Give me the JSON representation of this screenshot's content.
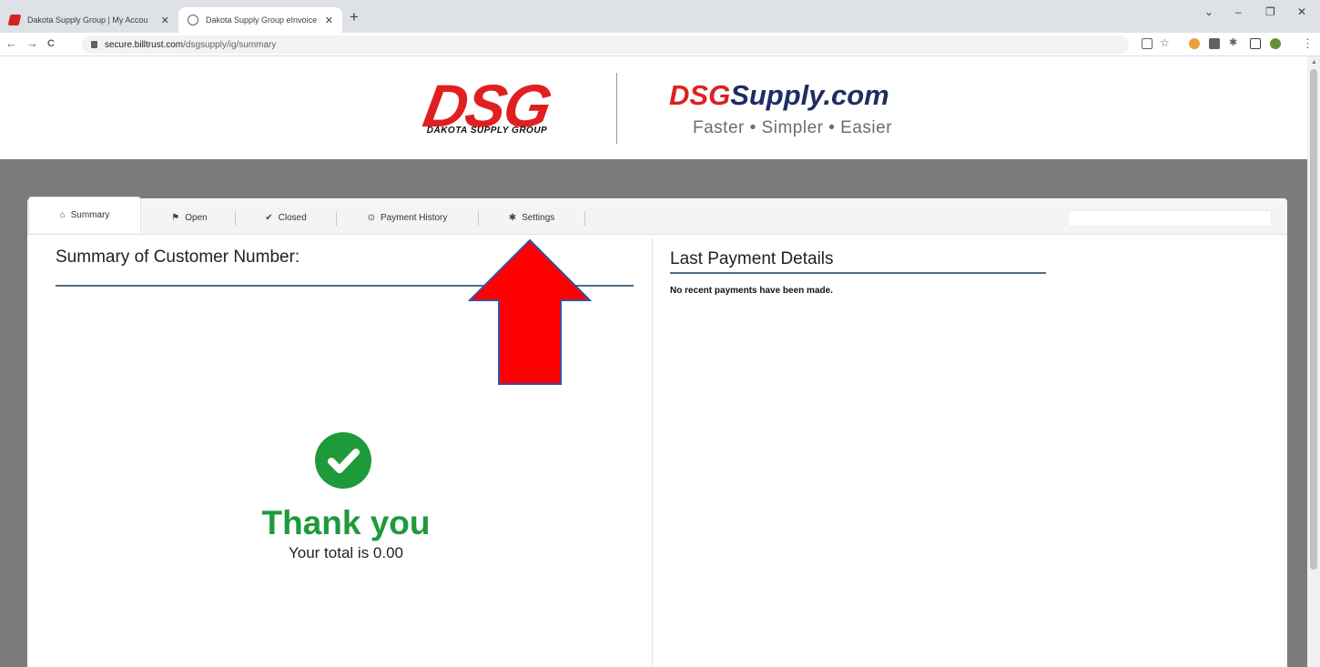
{
  "browser": {
    "tabs": [
      {
        "title": "Dakota Supply Group | My Accou",
        "close": "✕"
      },
      {
        "title": "Dakota Supply Group eInvoice C",
        "close": "✕"
      }
    ],
    "new_tab": "+",
    "window_controls": {
      "minimize": "–",
      "restore": "❐",
      "close": "✕",
      "chevron": "⌄"
    },
    "url_host": "secure.billtrust.com",
    "url_path": "/dsgsupply/ig/summary",
    "nav": {
      "back": "←",
      "forward": "→",
      "reload": "C",
      "menu": "⋮"
    }
  },
  "header": {
    "logo_main": "DSG",
    "logo_sub": "DAKOTA SUPPLY GROUP",
    "site_logo_prefix": "DSG",
    "site_logo_rest": "Supply.com",
    "tagline": "Faster • Simpler • Easier"
  },
  "tabs": [
    {
      "label": "Summary",
      "icon": "home-icon",
      "glyph": "⌂"
    },
    {
      "label": "Open",
      "icon": "flag-icon",
      "glyph": "⚑"
    },
    {
      "label": "Closed",
      "icon": "check-icon",
      "glyph": "✔"
    },
    {
      "label": "Payment History",
      "icon": "clock-icon",
      "glyph": "⊙"
    },
    {
      "label": "Settings",
      "icon": "gear-icon",
      "glyph": "✱"
    }
  ],
  "summary": {
    "title": "Summary of Customer Number:",
    "thank_you": "Thank you",
    "total_text": "Your total is 0.00"
  },
  "last_payment": {
    "title": "Last Payment Details",
    "message": "No recent payments have been made."
  },
  "colors": {
    "brand_red": "#e02020",
    "brand_navy": "#1f2d63",
    "success_green": "#1e9a3a",
    "rule_blue": "#4f6e86",
    "arrow_red": "#ff0000",
    "arrow_outline": "#3a4fa8"
  }
}
